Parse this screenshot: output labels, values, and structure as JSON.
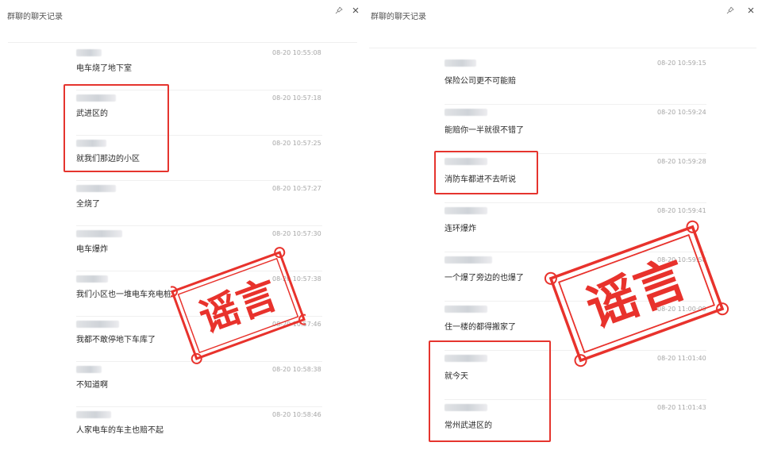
{
  "left_panel": {
    "title": "群聊的聊天记录",
    "pin_icon": "pin-icon",
    "close_icon": "close-icon",
    "messages": [
      {
        "text": "电车烧了地下室",
        "time": "08-20 10:55:08"
      },
      {
        "text": "武进区的",
        "time": "08-20 10:57:18"
      },
      {
        "text": "就我们那边的小区",
        "time": "08-20 10:57:25"
      },
      {
        "text": "全烧了",
        "time": "08-20 10:57:27"
      },
      {
        "text": "电车爆炸",
        "time": "08-20 10:57:30"
      },
      {
        "text": "我们小区也一堆电车充电桩",
        "time": "08-20 10:57:38"
      },
      {
        "text": "我都不敢停地下车库了",
        "time": "08-20 10:57:46"
      },
      {
        "text": "不知道啊",
        "time": "08-20 10:58:38"
      },
      {
        "text": "人家电车的车主也赔不起",
        "time": "08-20 10:58:46"
      }
    ],
    "stamp_text": "谣言"
  },
  "right_panel": {
    "title": "群聊的聊天记录",
    "pin_icon": "pin-icon",
    "close_icon": "close-icon",
    "messages": [
      {
        "text": "保险公司更不可能赔",
        "time": "08-20 10:59:15"
      },
      {
        "text": "能赔你一半就很不错了",
        "time": "08-20 10:59:24"
      },
      {
        "text": "消防车都进不去听说",
        "time": "08-20 10:59:28"
      },
      {
        "text": "连环爆炸",
        "time": "08-20 10:59:41"
      },
      {
        "text": "一个爆了旁边的也爆了",
        "time": "08-20 10:59:58"
      },
      {
        "text": "住一楼的都得搬家了",
        "time": "08-20 11:00:09"
      },
      {
        "text": "就今天",
        "time": "08-20 11:01:40"
      },
      {
        "text": "常州武进区的",
        "time": "08-20 11:01:43"
      }
    ],
    "stamp_text": "谣言"
  },
  "colors": {
    "highlight": "#e5342e",
    "stamp": "#e8322c",
    "timestamp": "#a6a6a6"
  }
}
